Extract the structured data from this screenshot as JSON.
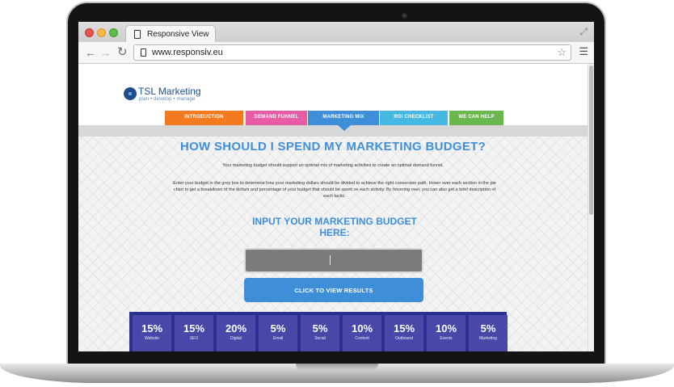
{
  "browser": {
    "tab_title": "Responsive View",
    "url": "www.responsiv.eu",
    "back_icon": "arrow-left-icon",
    "forward_icon": "arrow-right-icon",
    "reload_icon": "reload-icon",
    "star_icon": "star-icon",
    "menu_icon": "hamburger-menu-icon"
  },
  "site": {
    "logo_name": "TSL Marketing",
    "logo_tagline": "plan • develop • manage",
    "nav": [
      {
        "label": "INTRODUCTION",
        "color": "#f47a20"
      },
      {
        "label": "DEMAND FUNNEL",
        "color": "#e85ca6"
      },
      {
        "label": "MARKETING MIX",
        "color": "#3f8fd8",
        "active": true
      },
      {
        "label": "ROI CHECKLIST",
        "color": "#46b8e2"
      },
      {
        "label": "WE CAN HELP",
        "color": "#6ab74f"
      }
    ]
  },
  "main": {
    "title": "HOW SHOULD I SPEND MY MARKETING BUDGET?",
    "intro_1": "Your marketing budget should support an optimal mix of marketing activities to create an optimal demand funnel.",
    "intro_2": "Enter your budget in the grey box to determine how your marketing dollars should be divided to achieve the right conversion path. Hover over each section in the pie chart to get a breakdown of the dollars and percentage of your budget that should be spent on each activity. By hovering over, you can also get a brief description of each tactic.",
    "budget_title": "INPUT YOUR MARKETING BUDGET HERE:",
    "budget_value": "",
    "results_button": "CLICK TO VIEW RESULTS"
  },
  "tiles": [
    {
      "pct": "15%",
      "label": "Website"
    },
    {
      "pct": "15%",
      "label": "SEO"
    },
    {
      "pct": "20%",
      "label": "Digital"
    },
    {
      "pct": "5%",
      "label": "Email"
    },
    {
      "pct": "5%",
      "label": "Social"
    },
    {
      "pct": "10%",
      "label": "Content"
    },
    {
      "pct": "15%",
      "label": "Outbound"
    },
    {
      "pct": "10%",
      "label": "Events"
    },
    {
      "pct": "5%",
      "label": "Marketing"
    }
  ],
  "colors": {
    "accent_blue": "#3f8fd8",
    "tile_bg": "#4748a8",
    "tile_strip": "#2c2f8f"
  }
}
